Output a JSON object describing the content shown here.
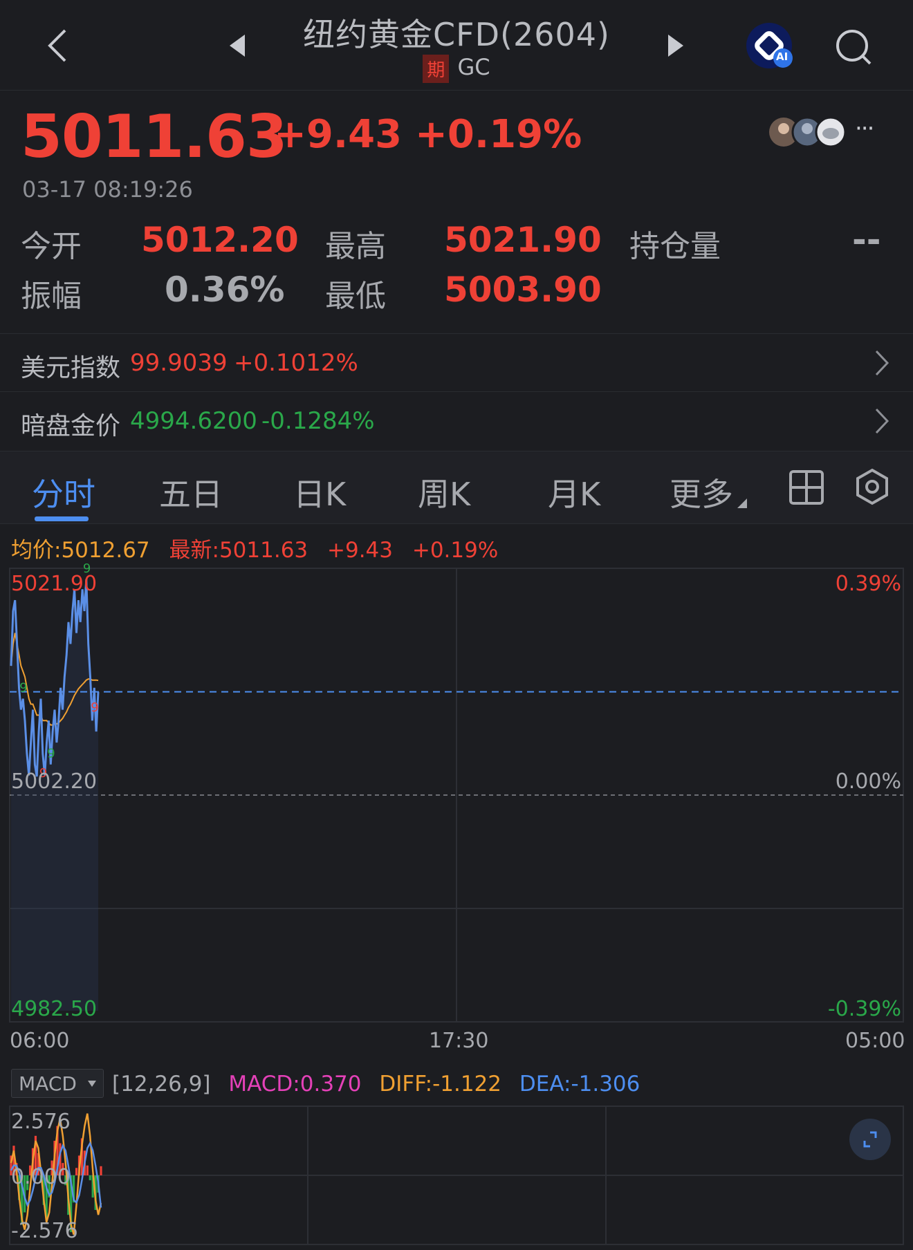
{
  "header": {
    "title": "纽约黄金CFD(2604)",
    "badge": "期",
    "code": "GC",
    "ai_label": "AI"
  },
  "quote": {
    "price": "5011.63",
    "change": "+9.43",
    "change_pct": "+0.19%",
    "timestamp": "03-17 08:19:26",
    "more": "···"
  },
  "stats": {
    "open_label": "今开",
    "open": "5012.20",
    "high_label": "最高",
    "high": "5021.90",
    "oi_label": "持仓量",
    "oi": "--",
    "amp_label": "振幅",
    "amp": "0.36%",
    "low_label": "最低",
    "low": "5003.90"
  },
  "links": [
    {
      "label": "美元指数",
      "value": "99.9039",
      "change": "+0.1012%",
      "color": "#ef4136"
    },
    {
      "label": "暗盘金价",
      "value": "4994.6200",
      "change": "-0.1284%",
      "color": "#2aa84a"
    }
  ],
  "tabs": [
    "分时",
    "五日",
    "日K",
    "周K",
    "月K",
    "更多"
  ],
  "active_tab": 0,
  "legend": {
    "avg": "均价:5012.67",
    "latest": "最新:5011.63",
    "change": "+9.43",
    "pct": "+0.19%"
  },
  "chart_data": {
    "type": "line",
    "price_axis": {
      "top": "5021.90",
      "mid": "5002.20",
      "bottom": "4982.50"
    },
    "pct_axis": {
      "top": "0.39%",
      "mid": "0.00%",
      "bottom": "-0.39%"
    },
    "x_labels": [
      "06:00",
      "17:30",
      "05:00"
    ],
    "ylim": [
      4982.5,
      5021.9
    ],
    "last_price": 5011.63,
    "series": [
      {
        "name": "最新",
        "values": [
          5014,
          5019,
          5020,
          5016,
          5012,
          5010,
          5011,
          5009,
          5006,
          5004,
          5007,
          5010,
          5005,
          5003.9,
          5008,
          5011,
          5006,
          5004,
          5007,
          5009,
          5005,
          5008,
          5010,
          5007,
          5009,
          5012,
          5010,
          5013,
          5015,
          5018,
          5016,
          5019,
          5021,
          5017,
          5020,
          5018,
          5021,
          5019,
          5021.9,
          5016,
          5013,
          5009,
          5012,
          5008,
          5011.63
        ]
      },
      {
        "name": "均价",
        "values": [
          5014,
          5016,
          5017,
          5016,
          5015,
          5014,
          5013.5,
          5013,
          5012,
          5011,
          5010.5,
          5010.5,
          5010,
          5009.5,
          5009.5,
          5009.5,
          5009,
          5009,
          5009,
          5008.8,
          5008.6,
          5008.6,
          5008.7,
          5008.7,
          5008.8,
          5009,
          5009.2,
          5009.5,
          5009.8,
          5010.2,
          5010.5,
          5010.9,
          5011.3,
          5011.6,
          5011.9,
          5012.1,
          5012.3,
          5012.5,
          5012.7,
          5012.8,
          5012.8,
          5012.7,
          5012.7,
          5012.7,
          5012.67
        ]
      }
    ],
    "markers": [
      {
        "text": "9",
        "index": 6,
        "color": "#2aa84a"
      },
      {
        "text": "9",
        "index": 16,
        "color": "#ef4136"
      },
      {
        "text": "9",
        "index": 20,
        "color": "#2aa84a"
      },
      {
        "text": "9",
        "index": 38,
        "color": "#2aa84a"
      },
      {
        "text": "9",
        "index": 42,
        "color": "#ef4136"
      }
    ]
  },
  "macd": {
    "selector": "MACD",
    "params": "[12,26,9]",
    "macd": "MACD:0.370",
    "diff": "DIFF:-1.122",
    "dea": "DEA:-1.306",
    "axis_top": "2.576",
    "axis_mid": "0.000",
    "axis_bottom": "-2.576",
    "ylim": [
      -2.576,
      2.576
    ],
    "hist": [
      0.8,
      1.2,
      0.5,
      -1.0,
      -2.0,
      -1.5,
      -0.6,
      0.4,
      1.1,
      1.6,
      0.9,
      -0.3,
      -1.2,
      -1.8,
      -0.9,
      0.6,
      1.4,
      2.0,
      1.3,
      0.5,
      -0.4,
      -1.6,
      -2.3,
      -1.1,
      0.3,
      0.8,
      1.5,
      1.0,
      0.4,
      -0.2,
      -0.9,
      -1.4,
      -0.7,
      0.37
    ],
    "diff_values": [
      0.5,
      1.0,
      0.2,
      -0.9,
      -1.8,
      -2.2,
      -1.6,
      -0.5,
      0.6,
      1.4,
      1.1,
      0.1,
      -1.0,
      -1.9,
      -1.5,
      -0.4,
      0.8,
      1.8,
      2.3,
      1.6,
      0.5,
      -0.9,
      -2.0,
      -2.4,
      -1.2,
      0.2,
      1.2,
      2.0,
      2.5,
      1.6,
      0.2,
      -1.0,
      -1.6,
      -1.122
    ],
    "dea_values": [
      0.2,
      0.4,
      0.4,
      0.1,
      -0.4,
      -0.9,
      -1.2,
      -1.0,
      -0.6,
      -0.1,
      0.3,
      0.3,
      0.0,
      -0.5,
      -0.8,
      -0.7,
      -0.3,
      0.3,
      0.9,
      1.2,
      1.0,
      0.4,
      -0.3,
      -1.0,
      -1.1,
      -0.8,
      -0.2,
      0.5,
      1.1,
      1.3,
      1.0,
      0.4,
      -0.3,
      -1.306
    ]
  }
}
